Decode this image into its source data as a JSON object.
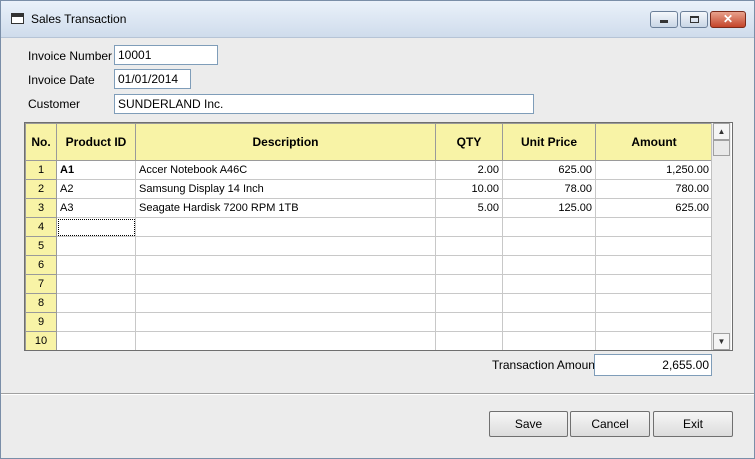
{
  "window": {
    "title": "Sales Transaction",
    "close_glyph": "✕"
  },
  "form": {
    "invoice_number_label": "Invoice Number",
    "invoice_number": "10001",
    "invoice_date_label": "Invoice Date",
    "invoice_date": "01/01/2014",
    "customer_label": "Customer",
    "customer": "SUNDERLAND Inc."
  },
  "grid": {
    "columns": [
      "No.",
      "Product ID",
      "Description",
      "QTY",
      "Unit Price",
      "Amount"
    ],
    "rows": [
      {
        "no": "1",
        "product_id": "A1",
        "description": "Accer Notebook A46C",
        "qty": "2.00",
        "unit_price": "625.00",
        "amount": "1,250.00"
      },
      {
        "no": "2",
        "product_id": "A2",
        "description": "Samsung Display 14 Inch",
        "qty": "10.00",
        "unit_price": "78.00",
        "amount": "780.00"
      },
      {
        "no": "3",
        "product_id": "A3",
        "description": "Seagate Hardisk 7200 RPM 1TB",
        "qty": "5.00",
        "unit_price": "125.00",
        "amount": "625.00"
      },
      {
        "no": "4",
        "product_id": "",
        "description": "",
        "qty": "",
        "unit_price": "",
        "amount": ""
      },
      {
        "no": "5",
        "product_id": "",
        "description": "",
        "qty": "",
        "unit_price": "",
        "amount": ""
      },
      {
        "no": "6",
        "product_id": "",
        "description": "",
        "qty": "",
        "unit_price": "",
        "amount": ""
      },
      {
        "no": "7",
        "product_id": "",
        "description": "",
        "qty": "",
        "unit_price": "",
        "amount": ""
      },
      {
        "no": "8",
        "product_id": "",
        "description": "",
        "qty": "",
        "unit_price": "",
        "amount": ""
      },
      {
        "no": "9",
        "product_id": "",
        "description": "",
        "qty": "",
        "unit_price": "",
        "amount": ""
      },
      {
        "no": "10",
        "product_id": "",
        "description": "",
        "qty": "",
        "unit_price": "",
        "amount": ""
      }
    ]
  },
  "summary": {
    "transaction_amount_label": "Transaction Amount",
    "transaction_amount": "2,655.00"
  },
  "buttons": {
    "save": "Save",
    "cancel": "Cancel",
    "exit": "Exit"
  },
  "icons": {
    "app": "form-window-icon",
    "scroll_up": "▲",
    "scroll_down": "▼"
  },
  "colors": {
    "header_fill": "#f8f3a6",
    "window_bg": "#ececec"
  }
}
